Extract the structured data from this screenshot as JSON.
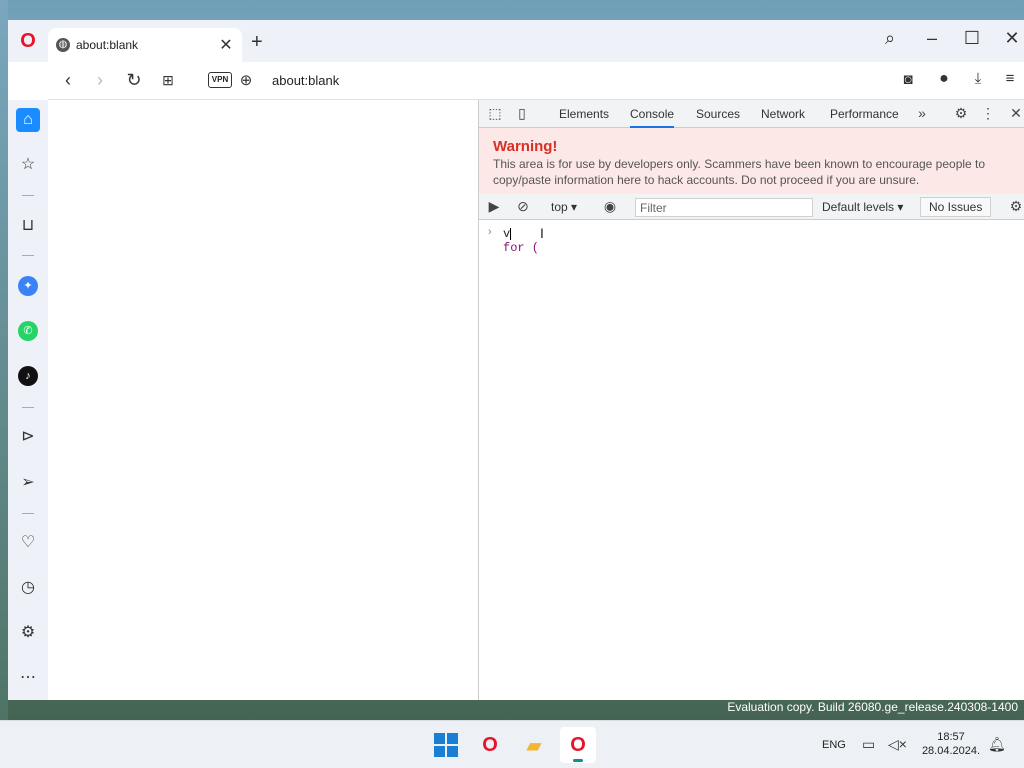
{
  "browser": {
    "tab_title": "about:blank",
    "url": "about:blank",
    "vpn_label": "VPN"
  },
  "devtools": {
    "tabs": [
      "Elements",
      "Console",
      "Sources",
      "Network",
      "Performance"
    ],
    "warning_title": "Warning!",
    "warning_body": "This area is for use by developers only. Scammers have been known to encourage people to copy/paste information here to hack accounts. Do not proceed if you are unsure.",
    "context": "top",
    "filter_placeholder": "Filter",
    "levels": "Default levels",
    "issues": "No Issues",
    "console_input_line1": "v",
    "console_input_line2": "for ("
  },
  "desktop": {
    "watermark": "Evaluation copy. Build 26080.ge_release.240308-1400",
    "language": "ENG",
    "time": "18:57",
    "date": "28.04.2024."
  },
  "colors": {
    "accent": "#1a8cff",
    "opera_red": "#e5152d",
    "warning_red": "#d93025"
  }
}
